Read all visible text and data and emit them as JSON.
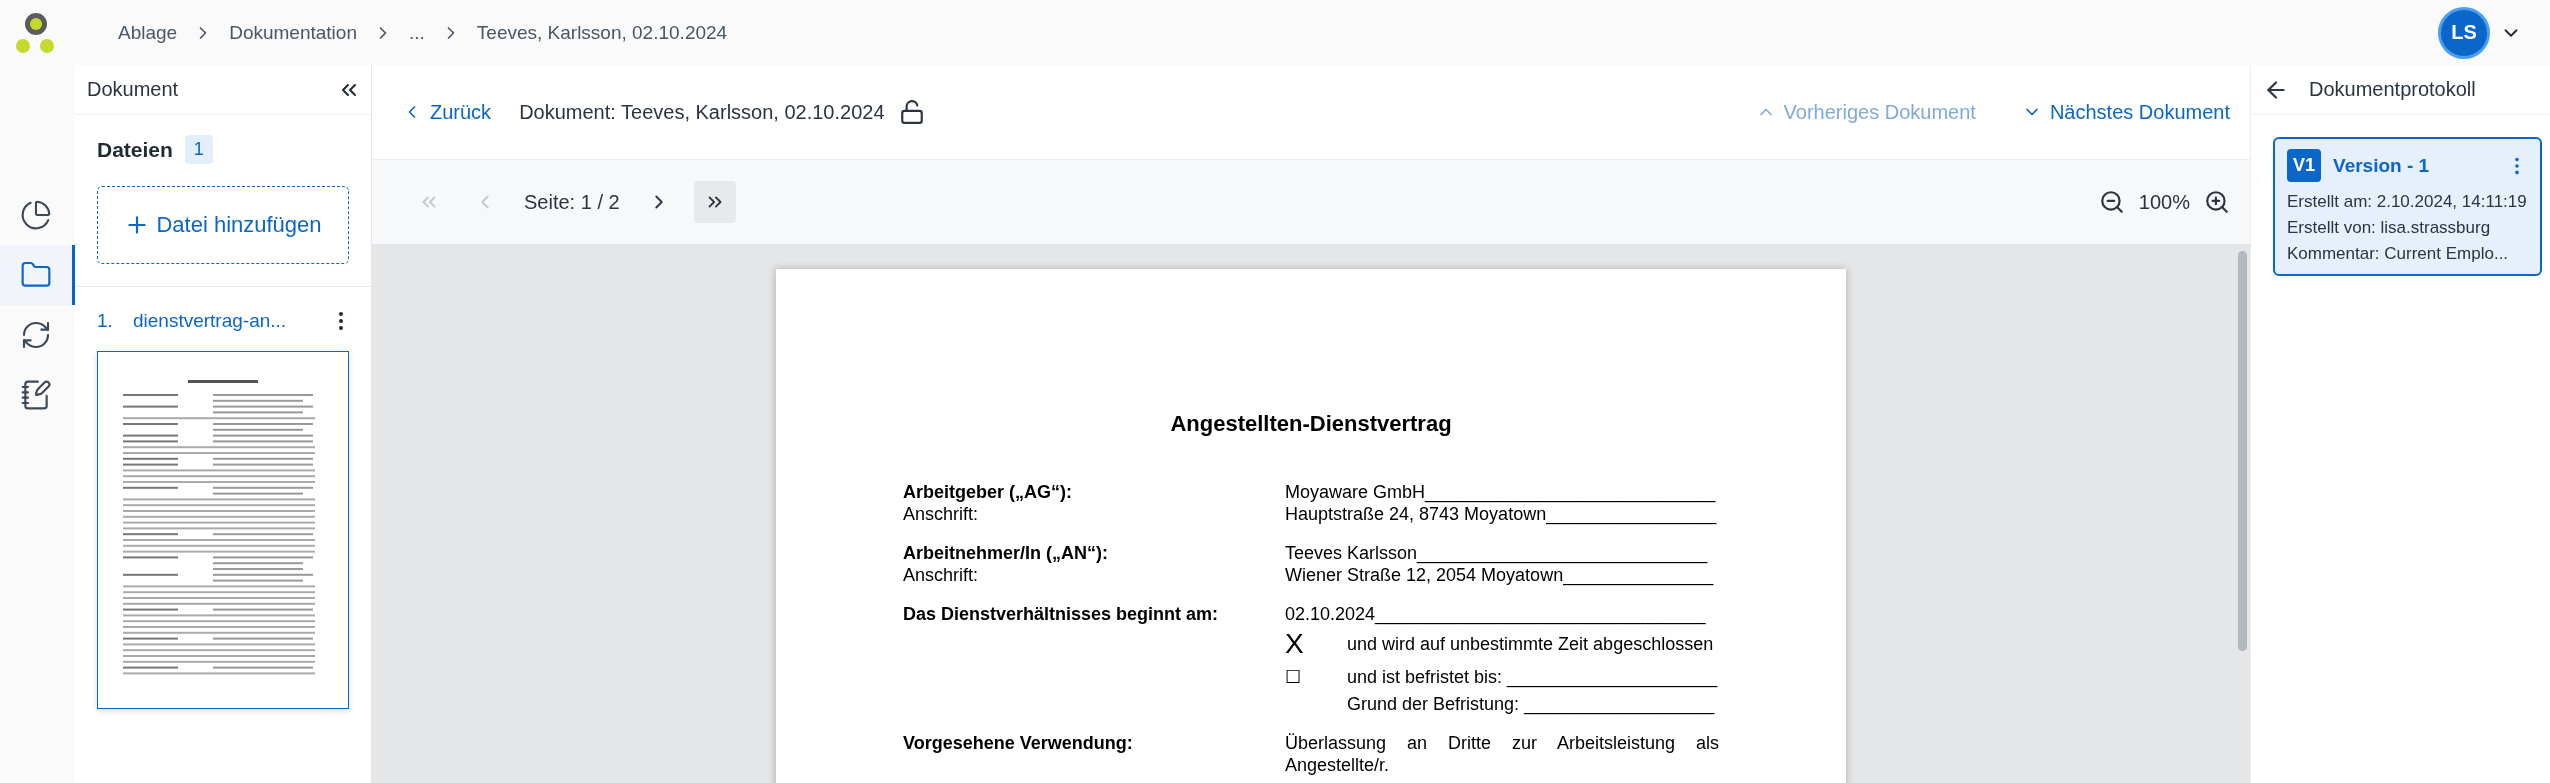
{
  "breadcrumbs": [
    "Ablage",
    "Dokumentation",
    "...",
    "Teeves, Karlsson, 02.10.2024"
  ],
  "user": {
    "initials": "LS"
  },
  "rail": [
    {
      "kind": "chart",
      "selected": false
    },
    {
      "kind": "folder",
      "selected": true
    },
    {
      "kind": "sync",
      "selected": false
    },
    {
      "kind": "notes",
      "selected": false
    }
  ],
  "left_panel": {
    "title": "Dokument",
    "files_label": "Dateien",
    "files_count": "1",
    "add_label": "Datei hinzufügen",
    "files": [
      {
        "number": "1.",
        "name": "dienstvertrag-an...",
        "selected": true
      }
    ]
  },
  "toolbar": {
    "back": "Zurück",
    "title": "Dokument: Teeves, Karlsson, 02.10.2024",
    "locked": false,
    "prev": {
      "label": "Vorheriges Dokument",
      "disabled": true
    },
    "next": {
      "label": "Nächstes Dokument",
      "disabled": false
    }
  },
  "pager": {
    "before": [
      {
        "kind": "first",
        "disabled": true,
        "focused": false
      },
      {
        "kind": "prev",
        "disabled": true,
        "focused": false
      }
    ],
    "page_label": "Seite: 1 / 2",
    "after": [
      {
        "kind": "next",
        "disabled": false,
        "focused": false
      },
      {
        "kind": "last",
        "disabled": false,
        "focused": true
      }
    ],
    "zoom": "100%"
  },
  "document": {
    "title": "Angestellten-Dienstvertrag",
    "blocks": [
      {
        "lines": [
          {
            "kind": "pair",
            "left": "Arbeitgeber („AG“):",
            "bold": true,
            "right": "Moyaware GmbH_____________________________"
          },
          {
            "kind": "pair",
            "left": "Anschrift:",
            "bold": false,
            "right": "Hauptstraße 24, 8743 Moyatown_________________"
          }
        ]
      },
      {
        "lines": [
          {
            "kind": "pair",
            "left": "Arbeitnehmer/In („AN“):",
            "bold": true,
            "right": "Teeves Karlsson_____________________________"
          },
          {
            "kind": "pair",
            "left": "Anschrift:",
            "bold": false,
            "right": "Wiener Straße 12, 2054 Moyatown_______________"
          }
        ]
      },
      {
        "lines": [
          {
            "kind": "pair",
            "left": "Das Dienstverhältnisses beginnt am:",
            "bold": true,
            "right": "02.10.2024_________________________________"
          },
          {
            "kind": "option",
            "mark": "X",
            "text": "und wird auf unbestimmte Zeit abgeschlossen"
          },
          {
            "kind": "option",
            "mark": "☐",
            "text": "und ist befristet bis: _____________________"
          },
          {
            "kind": "continuation",
            "text": "Grund der Befristung: ___________________"
          }
        ]
      },
      {
        "lines": [
          {
            "kind": "pair",
            "left": "Vorgesehene Verwendung:",
            "bold": true,
            "right": "Überlassung an Dritte zur Arbeitsleistung als Angestellte/r.",
            "justify": true
          }
        ]
      }
    ]
  },
  "protocol": {
    "title": "Dokumentprotokoll",
    "versions": [
      {
        "badge": "V1",
        "title": "Version - 1",
        "selected": true,
        "lines": [
          "Erstellt am: 2.10.2024, 14:11:19",
          "Erstellt von: lisa.strassburg",
          "Kommentar: Current Emplo..."
        ]
      }
    ]
  }
}
